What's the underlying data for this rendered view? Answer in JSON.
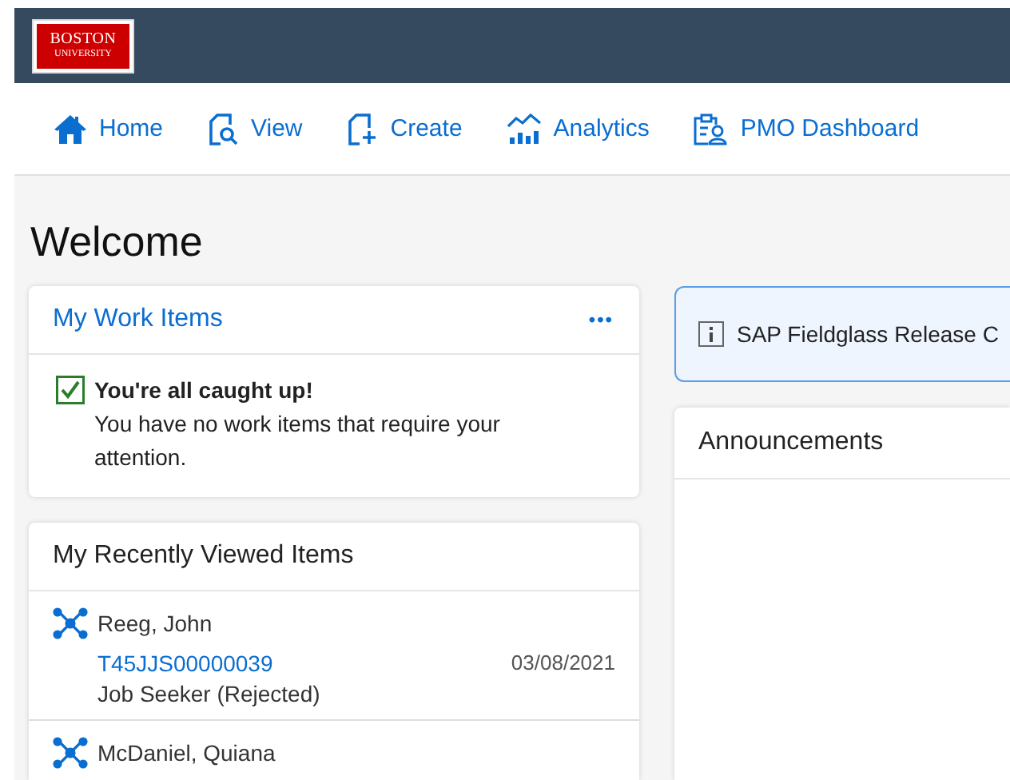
{
  "header": {
    "logo": [
      "BOSTON",
      "UNIVERSITY"
    ]
  },
  "nav": [
    {
      "label": "Home",
      "kind": "home"
    },
    {
      "label": "View",
      "kind": "view"
    },
    {
      "label": "Create",
      "kind": "create"
    },
    {
      "label": "Analytics",
      "kind": "analytics"
    },
    {
      "label": "PMO Dashboard",
      "kind": "dashboard"
    }
  ],
  "page_title": "Welcome",
  "work_items": {
    "title": "My Work Items",
    "more": "•••",
    "status_title": "You're all caught up!",
    "status_text": "You have no work items that require your attention."
  },
  "recent": {
    "title": "My Recently Viewed Items",
    "items": [
      {
        "name": "Reeg, John",
        "id": "T45JJS00000039",
        "date": "03/08/2021",
        "status": "Job Seeker (Rejected)"
      },
      {
        "name": "McDaniel, Quiana"
      }
    ]
  },
  "notice": {
    "text": "SAP Fieldglass Release C"
  },
  "announcements": {
    "title": "Announcements"
  }
}
